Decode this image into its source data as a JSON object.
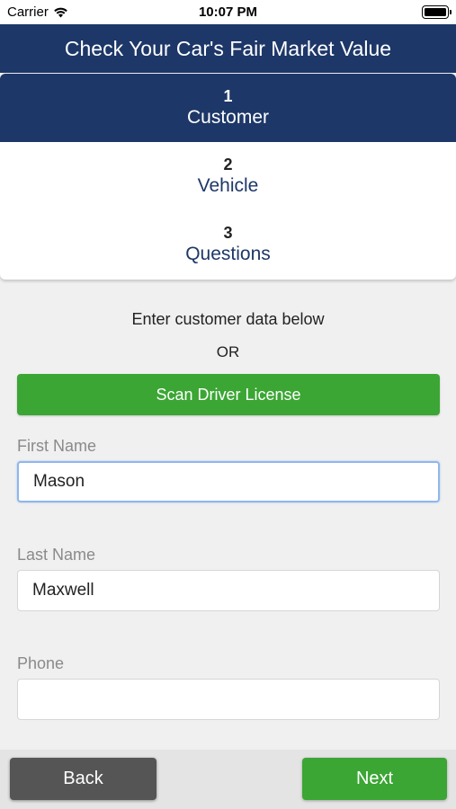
{
  "status_bar": {
    "carrier": "Carrier",
    "time": "10:07 PM",
    "wifi_icon": "wifi-icon",
    "battery_icon": "battery-icon"
  },
  "nav": {
    "title": "Check Your Car's Fair Market Value"
  },
  "steps": [
    {
      "number": "1",
      "label": "Customer",
      "active": true
    },
    {
      "number": "2",
      "label": "Vehicle",
      "active": false
    },
    {
      "number": "3",
      "label": "Questions",
      "active": false
    }
  ],
  "form": {
    "instruction": "Enter customer data below",
    "or_text": "OR",
    "scan_label": "Scan Driver License",
    "first_name": {
      "label": "First Name",
      "value": "Mason"
    },
    "last_name": {
      "label": "Last Name",
      "value": "Maxwell"
    },
    "phone": {
      "label": "Phone",
      "value": ""
    }
  },
  "footer": {
    "back_label": "Back",
    "next_label": "Next"
  },
  "colors": {
    "navy": "#1d3768",
    "green": "#3ba634",
    "gray_button": "#555555",
    "background": "#f0f0f0"
  }
}
